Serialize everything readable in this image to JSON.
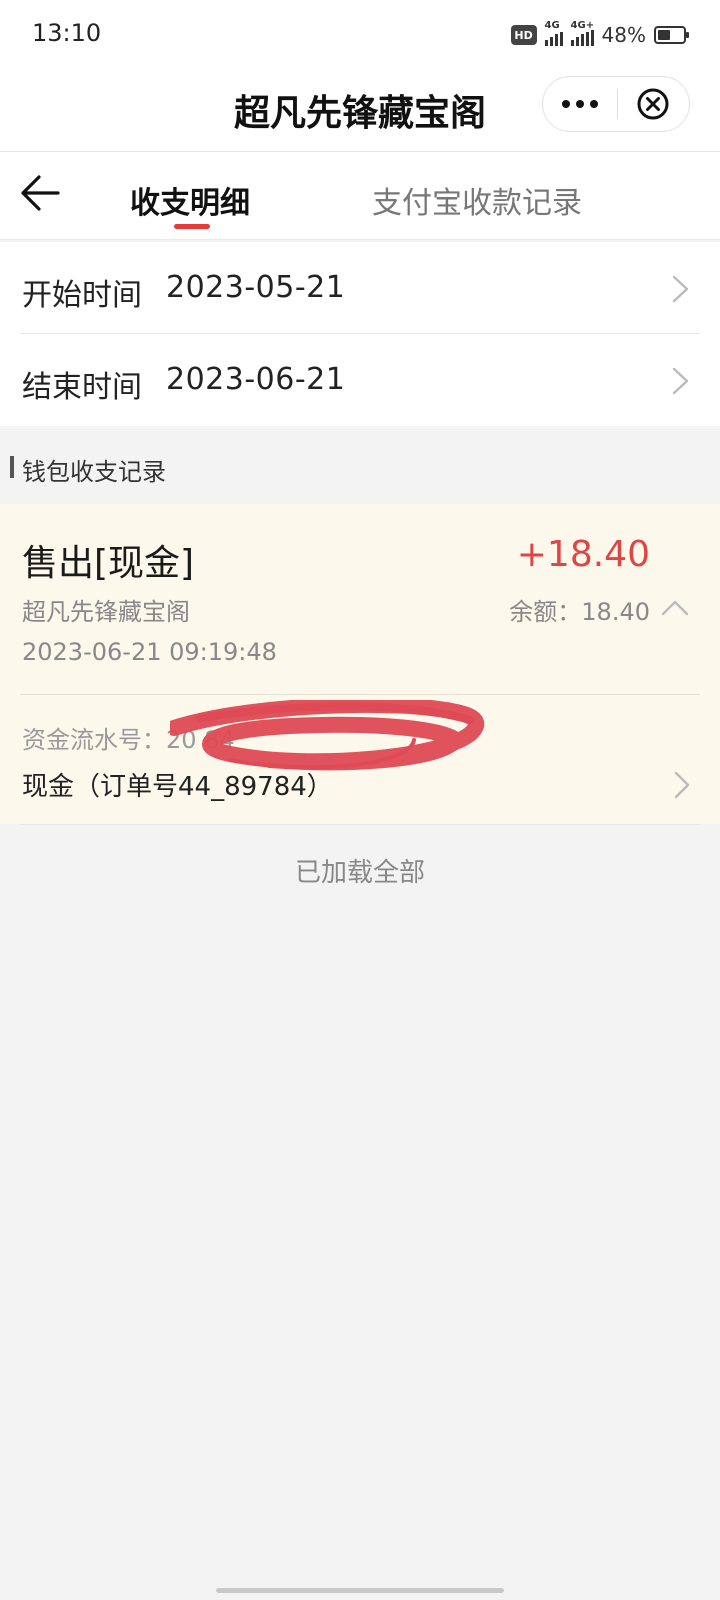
{
  "status_bar": {
    "time": "13:10",
    "hd_badge": "HD",
    "signal1_label": "4G",
    "signal2_label": "4G+",
    "battery_percent": "48%",
    "battery_level": 0.48
  },
  "header": {
    "title": "超凡先锋藏宝阁",
    "more_icon": "more-dots-icon",
    "close_icon": "close-circle-icon"
  },
  "tabs": {
    "back_icon": "arrow-left-icon",
    "items": [
      {
        "label": "收支明细",
        "active": true
      },
      {
        "label": "支付宝收款记录",
        "active": false
      }
    ],
    "accent_color": "#e63a3a"
  },
  "filters": {
    "start": {
      "label": "开始时间",
      "value": "2023-05-21"
    },
    "end": {
      "label": "结束时间",
      "value": "2023-06-21"
    }
  },
  "section": {
    "title": "钱包收支记录"
  },
  "records": [
    {
      "type": "售出[现金]",
      "amount": "+18.40",
      "shop": "超凡先锋藏宝阁",
      "balance": "余额：18.40",
      "time": "2023-06-21 09:19:48",
      "serial": "资金流水号：20                              84",
      "order": "现金（订单号44_89784）",
      "amount_color": "#e04545",
      "background": "#fdf8ec"
    }
  ],
  "footer": {
    "loaded_text": "已加载全部"
  }
}
